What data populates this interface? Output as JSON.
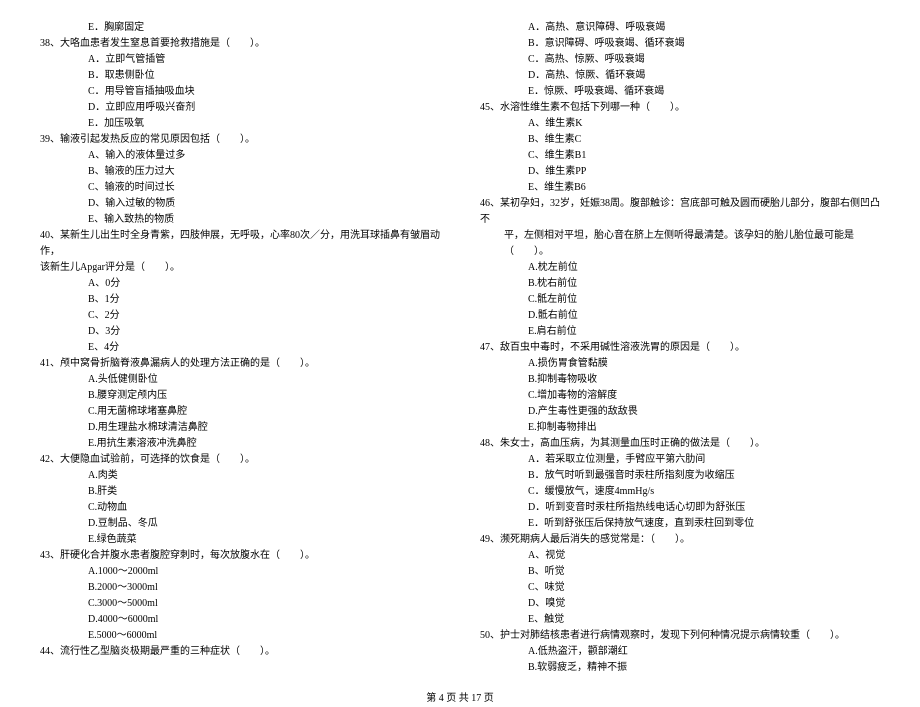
{
  "left": {
    "e37": "E．胸廓固定",
    "q38": "38、大咯血患者发生窒息首要抢救措施是（　　）。",
    "q38a": "A．立即气管插管",
    "q38b": "B．取患侧卧位",
    "q38c": "C．用导管盲插抽吸血块",
    "q38d": "D．立即应用呼吸兴奋剂",
    "q38e": "E．加压吸氧",
    "q39": "39、输液引起发热反应的常见原因包括（　　）。",
    "q39a": "A、输入的液体量过多",
    "q39b": "B、输液的压力过大",
    "q39c": "C、输液的时间过长",
    "q39d": "D、输入过敏的物质",
    "q39e": "E、输入致热的物质",
    "q40": "40、某新生儿出生时全身青紫，四肢伸展，无呼吸，心率80次／分，用洗耳球插鼻有皱眉动作，",
    "q40sub": "该新生儿Apgar评分是（　　）。",
    "q40a": "A、0分",
    "q40b": "B、1分",
    "q40c": "C、2分",
    "q40d": "D、3分",
    "q40e": "E、4分",
    "q41": "41、颅中窝骨折脑脊液鼻漏病人的处理方法正确的是（　　）。",
    "q41a": "A.头低健侧卧位",
    "q41b": "B.腰穿测定颅内压",
    "q41c": "C.用无菌棉球堵塞鼻腔",
    "q41d": "D.用生理盐水棉球清洁鼻腔",
    "q41e": "E.用抗生素溶液冲洗鼻腔",
    "q42": "42、大便隐血试验前，可选择的饮食是（　　）。",
    "q42a": "A.肉类",
    "q42b": "B.肝类",
    "q42c": "C.动物血",
    "q42d": "D.豆制品、冬瓜",
    "q42e": "E.绿色蔬菜",
    "q43": "43、肝硬化合并腹水患者腹腔穿刺时，每次放腹水在（　　）。",
    "q43a": "A.1000～2000ml",
    "q43b": "B.2000～3000ml",
    "q43c": "C.3000～5000ml",
    "q43d": "D.4000～6000ml",
    "q43e": "E.5000～6000ml",
    "q44": "44、流行性乙型脑炎极期最严重的三种症状（　　）。"
  },
  "right": {
    "q44a": "A．高热、意识障碍、呼吸衰竭",
    "q44b": "B．意识障碍、呼吸衰竭、循环衰竭",
    "q44c": "C．高热、惊厥、呼吸衰竭",
    "q44d": "D．高热、惊厥、循环衰竭",
    "q44e": "E．惊厥、呼吸衰竭、循环衰竭",
    "q45": "45、水溶性维生素不包括下列哪一种（　　）。",
    "q45a": "A、维生素K",
    "q45b": "B、维生素C",
    "q45c": "C、维生素B1",
    "q45d": "D、维生素PP",
    "q45e": "E、维生素B6",
    "q46": "46、某初孕妇，32岁，妊娠38周。腹部触诊：宫底部可触及圆而硬胎儿部分，腹部右侧凹凸不",
    "q46sub": "平，左侧相对平坦，胎心音在脐上左侧听得最清楚。该孕妇的胎儿胎位最可能是（　　）。",
    "q46a": "A.枕左前位",
    "q46b": "B.枕右前位",
    "q46c": "C.骶左前位",
    "q46d": "D.骶右前位",
    "q46e": "E.肩右前位",
    "q47": "47、敌百虫中毒时，不采用碱性溶液洗胃的原因是（　　）。",
    "q47a": "A.损伤胃食管黏膜",
    "q47b": "B.抑制毒物吸收",
    "q47c": "C.增加毒物的溶解度",
    "q47d": "D.产生毒性更强的敌敌畏",
    "q47e": "E.抑制毒物排出",
    "q48": "48、朱女士，高血压病，为其测量血压时正确的做法是（　　）。",
    "q48a": "A．若采取立位测量，手臂应平第六肋间",
    "q48b": "B．放气时听到最强音时汞柱所指刻度为收缩压",
    "q48c": "C．缓慢放气，速度4mmHg/s",
    "q48d": "D．听到变音时汞柱所指热线电话心切即为舒张压",
    "q48e": "E．听到舒张压后保持放气速度，直到汞柱回到零位",
    "q49": "49、濒死期病人最后消失的感觉常是：（　　）。",
    "q49a": "A、视觉",
    "q49b": "B、听觉",
    "q49c": "C、味觉",
    "q49d": "D、嗅觉",
    "q49e": "E、触觉",
    "q50": "50、护士对肺结核患者进行病情观察时，发现下列何种情况提示病情较重（　　）。",
    "q50a": "A.低热盗汗，颧部潮红",
    "q50b": "B.软弱疲乏，精神不振"
  },
  "footer": "第 4 页 共 17 页"
}
